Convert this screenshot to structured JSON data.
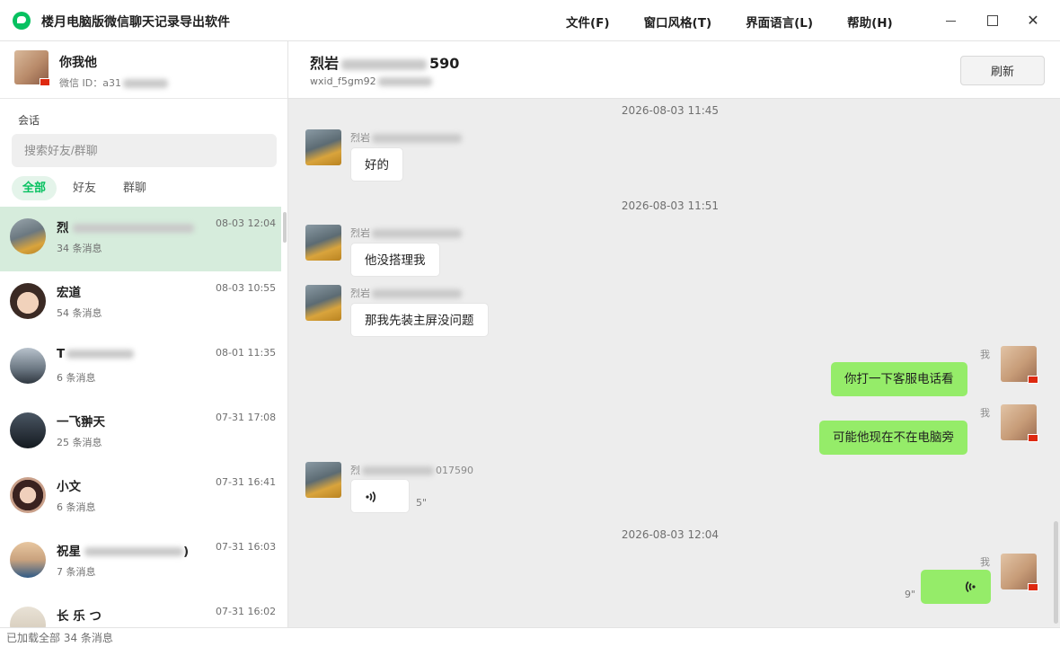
{
  "app": {
    "title": "楼月电脑版微信聊天记录导出软件"
  },
  "menu": [
    "文件(F)",
    "窗口风格(T)",
    "界面语言(L)",
    "帮助(H)"
  ],
  "window_controls": {
    "close": "✕"
  },
  "profile": {
    "name": "你我他",
    "id_label": "微信 ID：a31"
  },
  "sidebar": {
    "section_label": "会话",
    "search_placeholder": "搜索好友/群聊",
    "filters": [
      "全部",
      "好友",
      "群聊"
    ],
    "conversations": [
      {
        "name": "烈",
        "time": "08-03 12:04",
        "count": "34 条消息",
        "selected": true
      },
      {
        "name": "宏道",
        "time": "08-03 10:55",
        "count": "54 条消息"
      },
      {
        "name": "T",
        "time": "08-01 11:35",
        "count": "6 条消息"
      },
      {
        "name": "一飞翀天",
        "time": "07-31 17:08",
        "count": "25 条消息"
      },
      {
        "name": "小文",
        "time": "07-31 16:41",
        "count": "6 条消息"
      },
      {
        "name": "祝星",
        "name_suffix": ")",
        "time": "07-31 16:03",
        "count": "7 条消息"
      },
      {
        "name": "长 乐 つ",
        "time": "07-31 16:02",
        "count": ""
      }
    ]
  },
  "chat": {
    "title": "烈岩",
    "title_suffix": "590",
    "subtitle": "wxid_f5gm92",
    "refresh_label": "刷新",
    "timestamps": [
      "2026-08-03 11:45",
      "2026-08-03 11:51",
      "2026-08-03 12:04"
    ],
    "messages": [
      {
        "sender": "烈岩",
        "text": "好的"
      },
      {
        "sender": "烈岩",
        "text": "他没搭理我"
      },
      {
        "sender": "烈岩",
        "text": "那我先装主屏没问题"
      },
      {
        "sender": "我",
        "text": "你打一下客服电话看"
      },
      {
        "sender": "我",
        "text": "可能他现在不在电脑旁"
      },
      {
        "sender": "烈",
        "sender_suffix": "017590",
        "text": "",
        "voice_duration": "5\""
      },
      {
        "sender": "我",
        "text": "",
        "voice_duration": "9\""
      }
    ]
  },
  "status_bar": "已加载全部 34 条消息",
  "colors": {
    "accent": "#07c160",
    "selected_row": "#d6ecdc",
    "out_bubble": "#95ec69",
    "chat_bg": "#ededed"
  }
}
